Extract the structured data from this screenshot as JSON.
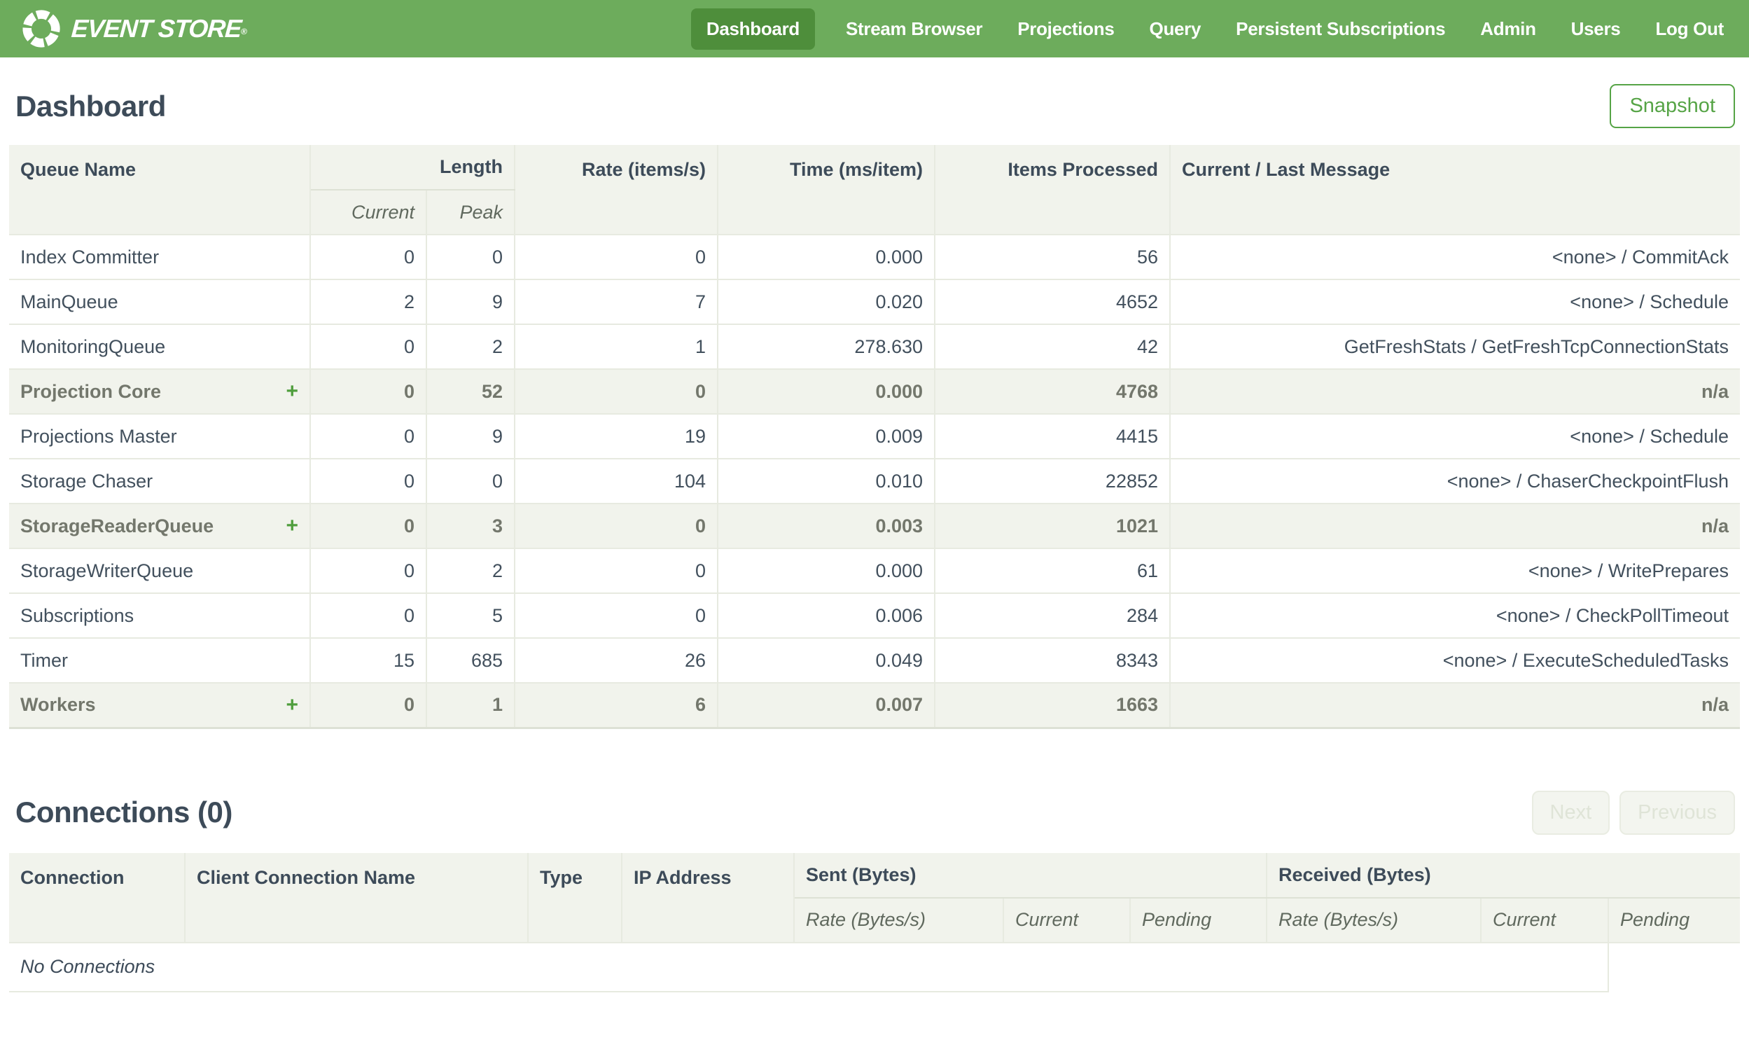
{
  "nav": {
    "brand": "EVENT STORE",
    "reg_mark": "®",
    "items": [
      {
        "label": "Dashboard",
        "active": true
      },
      {
        "label": "Stream Browser",
        "active": false
      },
      {
        "label": "Projections",
        "active": false
      },
      {
        "label": "Query",
        "active": false
      },
      {
        "label": "Persistent Subscriptions",
        "active": false
      },
      {
        "label": "Admin",
        "active": false
      },
      {
        "label": "Users",
        "active": false
      },
      {
        "label": "Log Out",
        "active": false
      }
    ]
  },
  "header": {
    "title": "Dashboard",
    "snapshot_label": "Snapshot"
  },
  "queues": {
    "columns": {
      "queue_name": "Queue Name",
      "length_group": "Length",
      "length_current": "Current",
      "length_peak": "Peak",
      "rate": "Rate (items/s)",
      "time": "Time (ms/item)",
      "items_processed": "Items Processed",
      "message": "Current / Last Message"
    },
    "expand_icon": "+",
    "rows": [
      {
        "name": "Index Committer",
        "group": false,
        "current": "0",
        "peak": "0",
        "rate": "0",
        "time": "0.000",
        "items": "56",
        "message": "<none> / CommitAck"
      },
      {
        "name": "MainQueue",
        "group": false,
        "current": "2",
        "peak": "9",
        "rate": "7",
        "time": "0.020",
        "items": "4652",
        "message": "<none> / Schedule"
      },
      {
        "name": "MonitoringQueue",
        "group": false,
        "current": "0",
        "peak": "2",
        "rate": "1",
        "time": "278.630",
        "items": "42",
        "message": "GetFreshStats / GetFreshTcpConnectionStats"
      },
      {
        "name": "Projection Core",
        "group": true,
        "current": "0",
        "peak": "52",
        "rate": "0",
        "time": "0.000",
        "items": "4768",
        "message": "n/a"
      },
      {
        "name": "Projections Master",
        "group": false,
        "current": "0",
        "peak": "9",
        "rate": "19",
        "time": "0.009",
        "items": "4415",
        "message": "<none> / Schedule"
      },
      {
        "name": "Storage Chaser",
        "group": false,
        "current": "0",
        "peak": "0",
        "rate": "104",
        "time": "0.010",
        "items": "22852",
        "message": "<none> / ChaserCheckpointFlush"
      },
      {
        "name": "StorageReaderQueue",
        "group": true,
        "current": "0",
        "peak": "3",
        "rate": "0",
        "time": "0.003",
        "items": "1021",
        "message": "n/a"
      },
      {
        "name": "StorageWriterQueue",
        "group": false,
        "current": "0",
        "peak": "2",
        "rate": "0",
        "time": "0.000",
        "items": "61",
        "message": "<none> / WritePrepares"
      },
      {
        "name": "Subscriptions",
        "group": false,
        "current": "0",
        "peak": "5",
        "rate": "0",
        "time": "0.006",
        "items": "284",
        "message": "<none> / CheckPollTimeout"
      },
      {
        "name": "Timer",
        "group": false,
        "current": "15",
        "peak": "685",
        "rate": "26",
        "time": "0.049",
        "items": "8343",
        "message": "<none> / ExecuteScheduledTasks"
      },
      {
        "name": "Workers",
        "group": true,
        "current": "0",
        "peak": "1",
        "rate": "6",
        "time": "0.007",
        "items": "1663",
        "message": "n/a"
      }
    ]
  },
  "connections": {
    "title": "Connections (0)",
    "next_label": "Next",
    "previous_label": "Previous",
    "columns": {
      "connection": "Connection",
      "client_connection_name": "Client Connection Name",
      "type": "Type",
      "ip_address": "IP Address",
      "sent_group": "Sent (Bytes)",
      "received_group": "Received (Bytes)",
      "rate": "Rate (Bytes/s)",
      "current": "Current",
      "pending": "Pending"
    },
    "empty_message": "No Connections"
  }
}
